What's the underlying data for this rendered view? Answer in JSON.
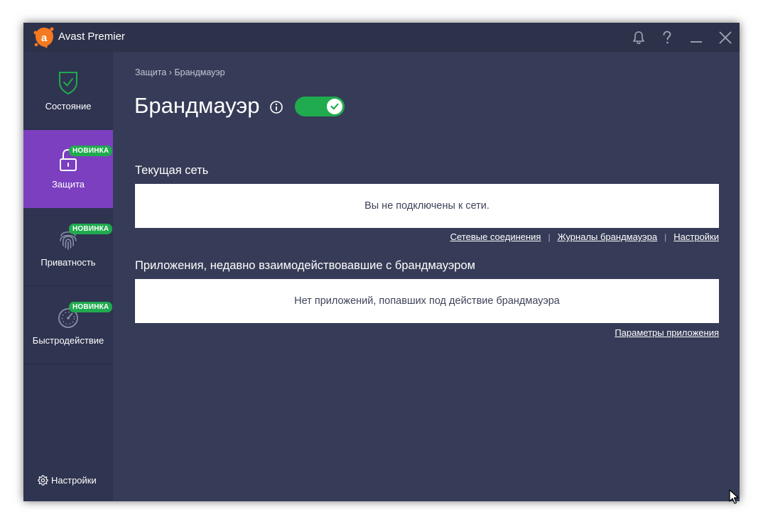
{
  "app": {
    "title": "Avast Premier"
  },
  "sidebar": {
    "items": [
      {
        "label": "Состояние",
        "icon": "shield-check-icon",
        "badge": ""
      },
      {
        "label": "Защита",
        "icon": "lock-icon",
        "badge": "НОВИНКА"
      },
      {
        "label": "Приватность",
        "icon": "fingerprint-icon",
        "badge": "НОВИНКА"
      },
      {
        "label": "Быстродействие",
        "icon": "speedometer-icon",
        "badge": "НОВИНКА"
      }
    ],
    "settings_label": "Настройки"
  },
  "breadcrumb": {
    "parent": "Защита",
    "separator": "›",
    "current": "Брандмауэр"
  },
  "page": {
    "title": "Брандмауэр",
    "toggle_on": true
  },
  "current_network": {
    "title": "Текущая сеть",
    "message": "Вы не подключены к сети.",
    "links": [
      "Сетевые соединения",
      "Журналы брандмауэра",
      "Настройки"
    ],
    "link_separator": "|"
  },
  "apps": {
    "title": "Приложения, недавно взаимодействовавшие с брандмауэром",
    "message": "Нет приложений, попавших под действие брандмауэра",
    "link": "Параметры приложения"
  },
  "colors": {
    "accent_purple": "#7b3fc0",
    "success_green": "#1fab4e",
    "background": "#363c57",
    "sidebar": "#2f3450",
    "logo_orange": "#f47920"
  }
}
